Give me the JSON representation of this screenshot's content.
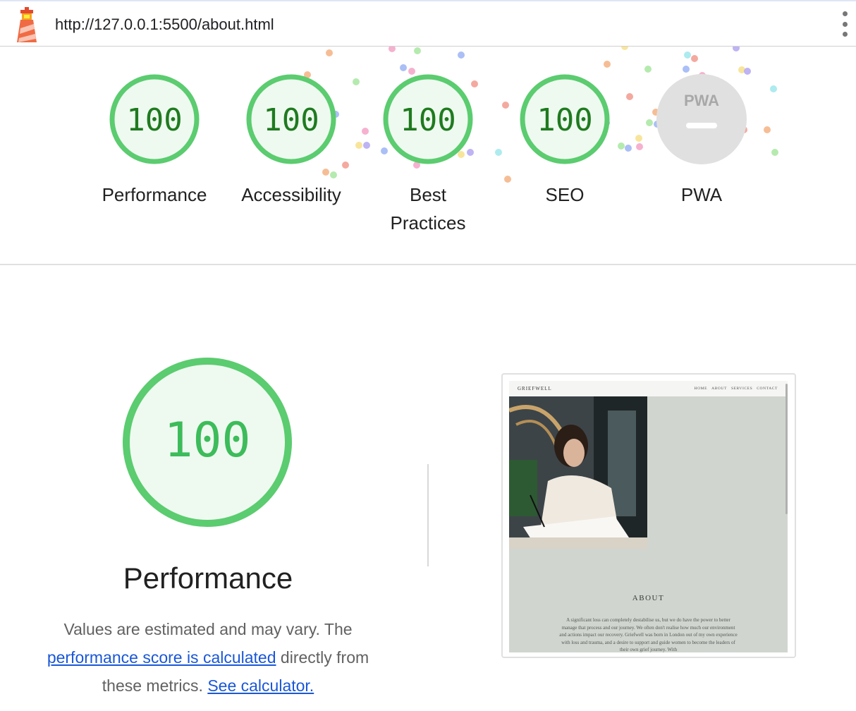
{
  "topbar": {
    "url": "http://127.0.0.1:5500/about.html",
    "logo_icon": "lighthouse-icon",
    "menu_icon": "kebab-menu-icon"
  },
  "gauges": [
    {
      "label": "Performance",
      "score": "100"
    },
    {
      "label": "Accessibility",
      "score": "100"
    },
    {
      "label": "Best Practices",
      "score": "100"
    },
    {
      "label": "SEO",
      "score": "100"
    },
    {
      "label": "PWA",
      "badge": "PWA"
    }
  ],
  "colors": {
    "pass_ring": "#5bcc6f",
    "pass_fill": "#eefaf0",
    "score_text": "#1f7a1f",
    "big_score_text": "#3cbc5a",
    "pwa_gray": "#e0e0e0",
    "link": "#1a57d6"
  },
  "performance": {
    "score": "100",
    "title": "Performance",
    "desc_part1": "Values are estimated and may vary. The ",
    "desc_link1": "performance score is calculated",
    "desc_part2": " directly from these metrics. ",
    "desc_link2": "See calculator."
  },
  "screenshot": {
    "brand": "GRIEFWELL",
    "menu": [
      "HOME",
      "ABOUT",
      "SERVICES",
      "CONTACT"
    ],
    "about_title": "ABOUT",
    "about_text": "A significant loss can completely destabilise us, but we do have the power to better manage that process and our journey. We often don't realise how much our environment and actions impact our recovery. Griefwell was born in London out of my own experience with loss and trauma, and a desire to support and guide women to become the leaders of their own grief journey. With"
  }
}
